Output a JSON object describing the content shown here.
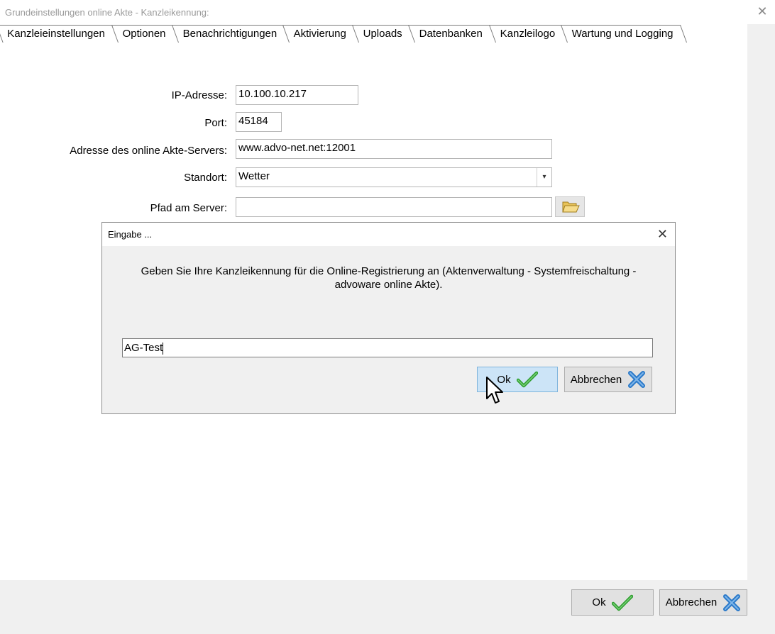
{
  "window": {
    "title": "Grundeinstellungen online Akte - Kanzleikennung:",
    "close_glyph": "✕"
  },
  "tabs": [
    {
      "label": "Kanzleieinstellungen",
      "active": true
    },
    {
      "label": "Optionen"
    },
    {
      "label": "Benachrichtigungen"
    },
    {
      "label": "Aktivierung"
    },
    {
      "label": "Uploads"
    },
    {
      "label": "Datenbanken"
    },
    {
      "label": "Kanzleilogo"
    },
    {
      "label": "Wartung und Logging"
    }
  ],
  "form": {
    "ip_label": "IP-Adresse:",
    "ip_value": "10.100.10.217",
    "port_label": "Port:",
    "port_value": "45184",
    "server_label": "Adresse des online Akte-Servers:",
    "server_value": "www.advo-net.net:12001",
    "standort_label": "Standort:",
    "standort_value": "Wetter",
    "pfad_label": "Pfad am Server:",
    "pfad_value": ""
  },
  "dialog": {
    "title": "Eingabe ...",
    "close_glyph": "✕",
    "message": "Geben Sie Ihre Kanzleikennung für die Online-Registrierung an (Aktenverwaltung - Systemfreischaltung - advoware online Akte).",
    "input_value": "AG-Test",
    "ok_label": "Ok",
    "cancel_label": "Abbrechen"
  },
  "footer": {
    "ok_label": "Ok",
    "cancel_label": "Abbrechen"
  },
  "icons": {
    "check": "check-icon",
    "cross": "cross-icon",
    "folder": "folder-icon",
    "dropdown": "chevron-down-icon",
    "cursor": "mouse-pointer-icon"
  },
  "colors": {
    "check_green": "#2e9e2e",
    "cross_blue": "#2a79c9",
    "ok_highlight": "#cce4f7"
  }
}
